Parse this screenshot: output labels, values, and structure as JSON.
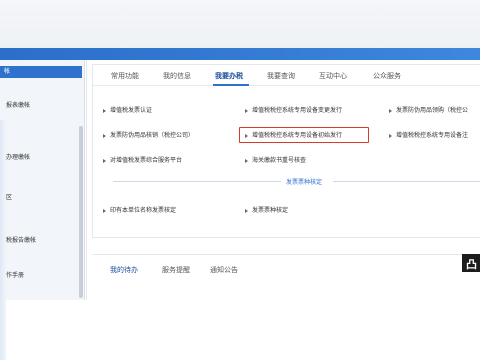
{
  "tabs": [
    {
      "label": "常用功能"
    },
    {
      "label": "我的信息"
    },
    {
      "label": "我要办税"
    },
    {
      "label": "我要查询"
    },
    {
      "label": "互动中心"
    },
    {
      "label": "公众服务"
    }
  ],
  "sidebar": {
    "items": [
      {
        "label": "帐"
      },
      {
        "label": "报表缴帐"
      },
      {
        "label": "办理缴帐"
      },
      {
        "label": "区"
      },
      {
        "label": "税报告缴帐"
      },
      {
        "label": "作手册"
      }
    ]
  },
  "links": {
    "row1": [
      "增值税发票认证",
      "增值税税控系统专用设备变更发行",
      "发票防伪用品领购（税控公"
    ],
    "row2": [
      "发票防伪用品核销（税控公司）",
      "增值税税控系统专用设备初始发行",
      "增值税税控系统专用设备注"
    ],
    "row3": [
      "对增值税发票综合服务平台",
      "海关缴款书重号核查"
    ]
  },
  "section": {
    "title": "发票票种核定"
  },
  "links2": [
    "印有本单位名称发票核定",
    "发票票种核定"
  ],
  "bottom_tabs": [
    {
      "label": "我的待办"
    },
    {
      "label": "服务提醒"
    },
    {
      "label": "通知公告"
    }
  ],
  "colors": {
    "accent": "#2f72cd",
    "highlight": "#d93a2b"
  }
}
